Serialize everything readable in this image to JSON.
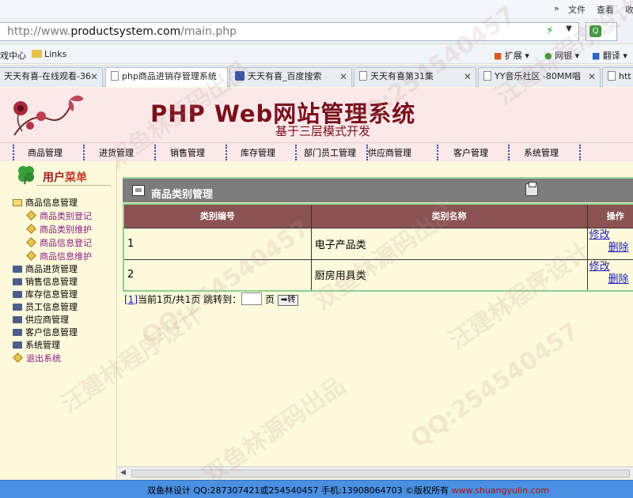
{
  "browser": {
    "menu": [
      "文件",
      "查看",
      "收"
    ],
    "menu_arrows": "»",
    "address": {
      "prefix": "http://www.",
      "host": "productsystem.com",
      "path": "/main.php"
    },
    "bookmarks": [
      {
        "label": "戏中心"
      },
      {
        "label": "Links"
      }
    ],
    "toolbar_right": [
      {
        "label": "扩展"
      },
      {
        "label": "网银"
      },
      {
        "label": "翻译"
      }
    ],
    "tabs": [
      {
        "label": "天天有喜-在线观看-36"
      },
      {
        "label": "php商品进销存管理系统"
      },
      {
        "label": "天天有喜_百度搜索"
      },
      {
        "label": "天天有喜第31集"
      },
      {
        "label": "YY音乐社区 -80MM唱"
      },
      {
        "label": "htt"
      }
    ]
  },
  "header": {
    "title": "PHP Web网站管理系统",
    "subtitle": "基于三层模式开发"
  },
  "nav": [
    "商品管理",
    "进货管理",
    "销售管理",
    "库存管理",
    "部门员工管理",
    "供应商管理",
    "客户管理",
    "系统管理"
  ],
  "sidebar": {
    "title_a": "用户",
    "title_b": "菜单",
    "items": [
      {
        "label": "商品信息管理"
      },
      {
        "label": "商品类别登记"
      },
      {
        "label": "商品类别维护"
      },
      {
        "label": "商品信息登记"
      },
      {
        "label": "商品信息维护"
      },
      {
        "label": "商品进货管理"
      },
      {
        "label": "销售信息管理"
      },
      {
        "label": "库存信息管理"
      },
      {
        "label": "员工信息管理"
      },
      {
        "label": "供应商管理"
      },
      {
        "label": "客户信息管理"
      },
      {
        "label": "系统管理"
      },
      {
        "label": "退出系统"
      }
    ]
  },
  "main": {
    "title": "商品类别管理",
    "columns": [
      "类别编号",
      "类别名称",
      "操作"
    ],
    "rows": [
      {
        "id": "1",
        "name": "电子产品类",
        "edit": "修改",
        "delete": "删除"
      },
      {
        "id": "2",
        "name": "厨房用具类",
        "edit": "修改",
        "delete": "删除"
      }
    ],
    "pager": {
      "page_link": "[1]",
      "text": "当前1页/共1页 跳转到：",
      "unit": "页",
      "go": "➡转"
    }
  },
  "footer": {
    "text": "双鱼林设计 QQ:287307421或254540457 手机:13908064703 ©版权所有 ",
    "url": "www.shuangyulin.com"
  },
  "watermarks": [
    "QQ:254540457",
    "双鱼林源码出品",
    "汪建林程序设计"
  ]
}
